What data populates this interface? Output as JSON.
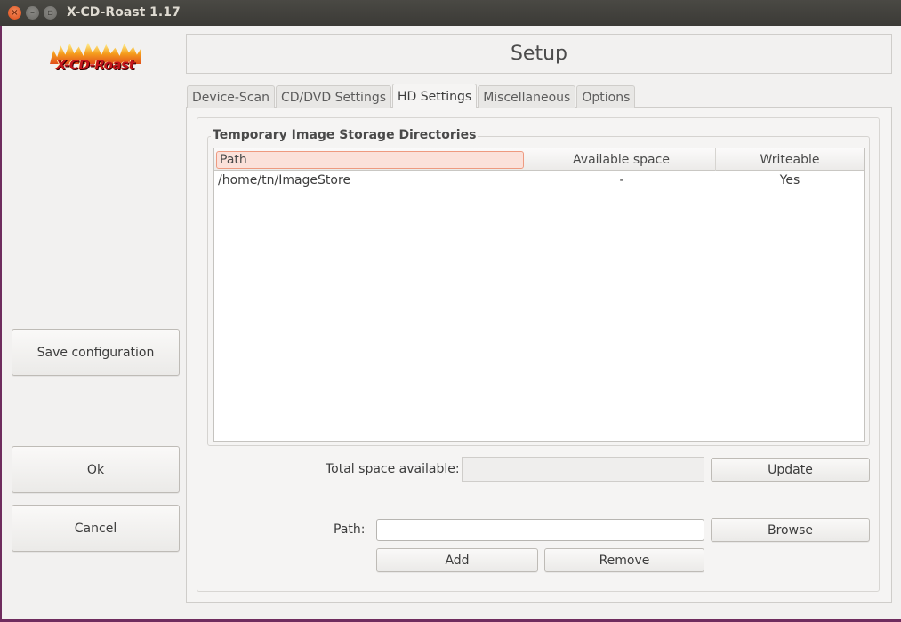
{
  "window": {
    "title": "X-CD-Roast 1.17",
    "controls": [
      "close",
      "minimize",
      "maximize"
    ]
  },
  "logo": {
    "text": "X-CD-Roast"
  },
  "sidebar": {
    "save_label": "Save configuration",
    "ok_label": "Ok",
    "cancel_label": "Cancel"
  },
  "header": {
    "title": "Setup"
  },
  "tabs": [
    {
      "label": "Device-Scan",
      "active": false
    },
    {
      "label": "CD/DVD Settings",
      "active": false
    },
    {
      "label": "HD Settings",
      "active": true
    },
    {
      "label": "Miscellaneous",
      "active": false
    },
    {
      "label": "Options",
      "active": false
    }
  ],
  "hd_settings": {
    "group_title": "Temporary Image Storage Directories",
    "columns": [
      "Path",
      "Available space",
      "Writeable"
    ],
    "rows": [
      {
        "path": "/home/tn/ImageStore",
        "available": "-",
        "writeable": "Yes"
      }
    ],
    "total_space_label": "Total space available:",
    "total_space_value": "",
    "update_label": "Update",
    "path_label": "Path:",
    "path_value": "",
    "browse_label": "Browse",
    "add_label": "Add",
    "remove_label": "Remove"
  }
}
